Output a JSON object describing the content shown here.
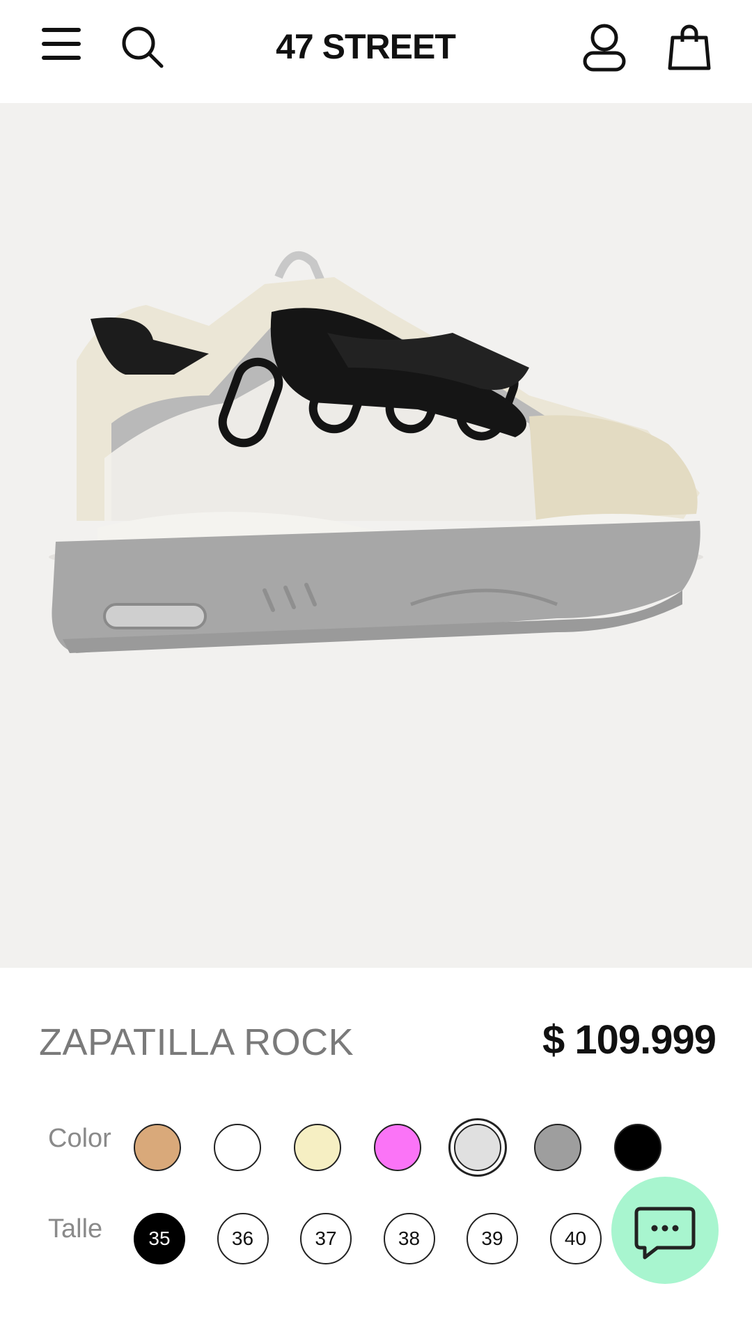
{
  "header": {
    "brand": "47 STREET",
    "icons": [
      "menu-icon",
      "search-icon",
      "account-icon",
      "shopping-bag-icon"
    ]
  },
  "product": {
    "image_alt": "Zapatilla Rock sneaker in grey and cream with black laces",
    "title": "ZAPATILLA ROCK",
    "price": "$ 109.999"
  },
  "color": {
    "label": "Color",
    "swatches": [
      {
        "hex": "#d9a97a",
        "selected": false
      },
      {
        "hex": "#ffffff",
        "selected": false
      },
      {
        "hex": "#f6efc3",
        "selected": false
      },
      {
        "hex": "#fb74f7",
        "selected": false
      },
      {
        "hex": "#e0e0e0",
        "selected": true
      },
      {
        "hex": "#9e9e9e",
        "selected": false
      },
      {
        "hex": "#000000",
        "selected": false
      }
    ]
  },
  "size": {
    "label": "Talle",
    "options": [
      "35",
      "36",
      "37",
      "38",
      "39",
      "40"
    ],
    "selected": "35"
  },
  "chat": {
    "icon": "chat-bubble-icon",
    "color": "#a8f5cf"
  }
}
